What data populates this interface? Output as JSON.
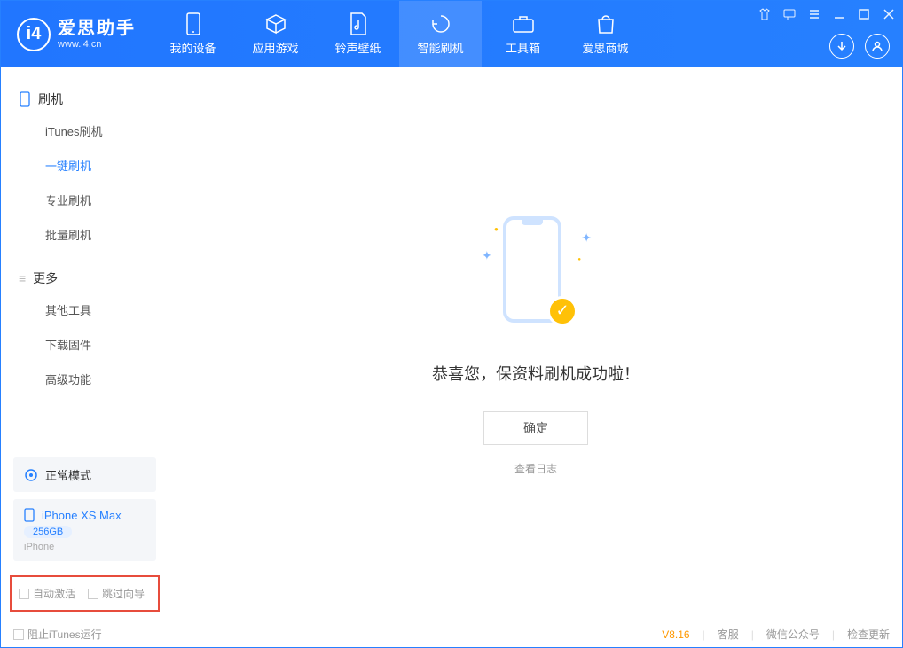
{
  "app": {
    "title": "爱思助手",
    "url": "www.i4.cn"
  },
  "tabs": [
    {
      "label": "我的设备"
    },
    {
      "label": "应用游戏"
    },
    {
      "label": "铃声壁纸"
    },
    {
      "label": "智能刷机"
    },
    {
      "label": "工具箱"
    },
    {
      "label": "爱思商城"
    }
  ],
  "sidebar": {
    "group1_title": "刷机",
    "items1": [
      {
        "label": "iTunes刷机"
      },
      {
        "label": "一键刷机"
      },
      {
        "label": "专业刷机"
      },
      {
        "label": "批量刷机"
      }
    ],
    "group2_title": "更多",
    "items2": [
      {
        "label": "其他工具"
      },
      {
        "label": "下载固件"
      },
      {
        "label": "高级功能"
      }
    ]
  },
  "device": {
    "mode": "正常模式",
    "name": "iPhone XS Max",
    "capacity": "256GB",
    "type": "iPhone"
  },
  "checks": {
    "auto_activate": "自动激活",
    "skip_guide": "跳过向导"
  },
  "main": {
    "message": "恭喜您，保资料刷机成功啦！",
    "ok": "确定",
    "view_log": "查看日志"
  },
  "footer": {
    "block_itunes": "阻止iTunes运行",
    "version": "V8.16",
    "support": "客服",
    "wechat": "微信公众号",
    "update": "检查更新"
  }
}
